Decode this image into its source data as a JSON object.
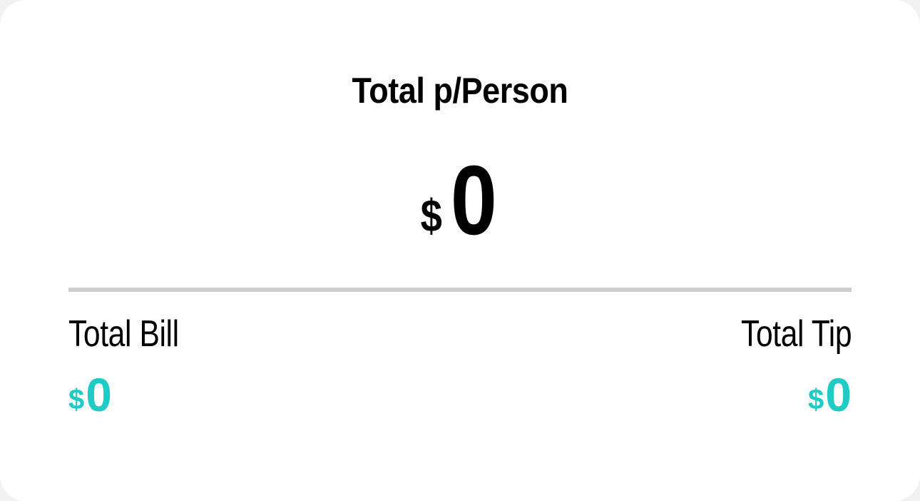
{
  "per_person": {
    "label": "Total p/Person",
    "currency": "$",
    "amount": "0"
  },
  "total_bill": {
    "label": "Total Bill",
    "currency": "$",
    "amount": "0"
  },
  "total_tip": {
    "label": "Total Tip",
    "currency": "$",
    "amount": "0"
  },
  "colors": {
    "accent": "#1fcbc4",
    "divider": "#cccccc",
    "text": "#000000",
    "card": "#ffffff"
  }
}
